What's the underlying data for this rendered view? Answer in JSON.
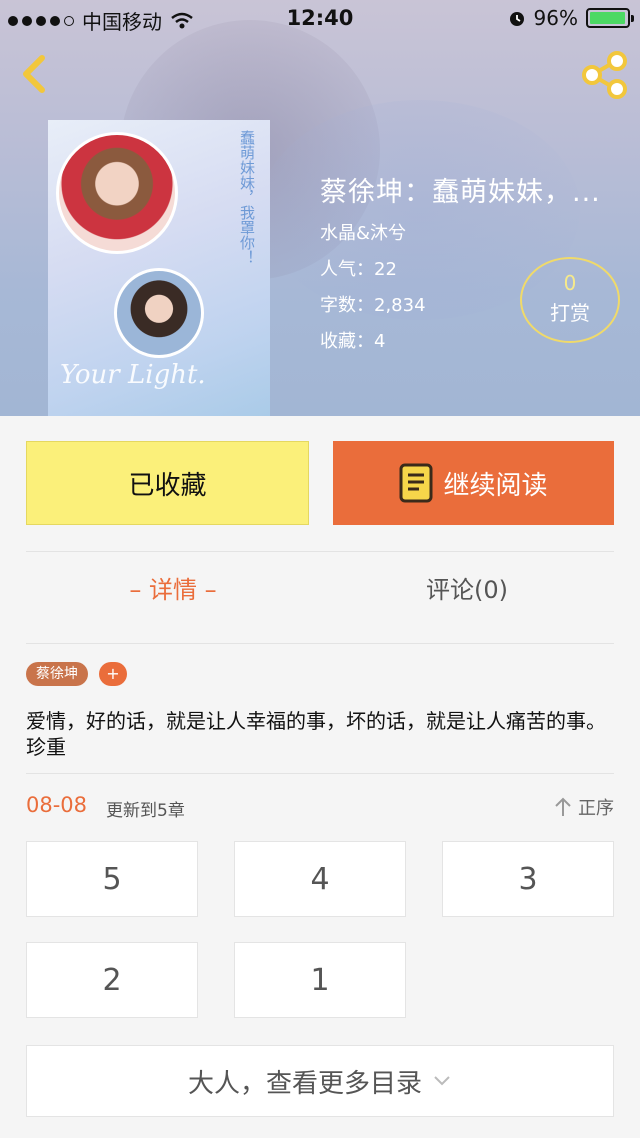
{
  "status_bar": {
    "carrier": "中国移动",
    "time": "12:40",
    "battery_percent": "96%",
    "battery_level": 0.96
  },
  "header": {
    "back_icon": "chevron-left-icon",
    "share_icon": "share-icon"
  },
  "cover": {
    "vertical_text": "蠢萌妹妹，我罩你！",
    "overlay_text": "Your Light."
  },
  "book": {
    "title": "蔡徐坤：蠢萌妹妹，...",
    "author": "水晶&沐兮",
    "popularity_label": "人气：",
    "popularity": "22",
    "words_label": "字数：",
    "words": "2,834",
    "favorites_label": "收藏：",
    "favorites": "4"
  },
  "reward": {
    "count": "0",
    "label": "打赏"
  },
  "actions": {
    "favorite_label": "已收藏",
    "read_label": "继续阅读"
  },
  "tabs": [
    {
      "label": "– 详情 –",
      "active": true
    },
    {
      "label": "评论(0)",
      "active": false
    }
  ],
  "tag": {
    "name": "蔡徐坤",
    "add": "+"
  },
  "description": "爱情，好的话，就是让人幸福的事，坏的话，就是让人痛苦的事。珍重",
  "update": {
    "date": "08-08",
    "text": "更新到5章",
    "sort_label": "正序"
  },
  "chapters": [
    "5",
    "4",
    "3",
    "2",
    "1"
  ],
  "more_label": "大人，查看更多目录",
  "colors": {
    "accent": "#ea6d3b",
    "favorite_bg": "#fbf07a",
    "tag_bg": "#c9744b"
  }
}
